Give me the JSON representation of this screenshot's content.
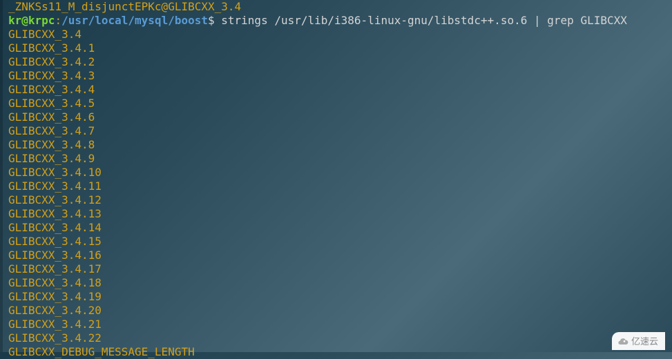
{
  "previous_line": "_ZNKSs11_M_disjunctEPKc@GLIBCXX_3.4",
  "prompt": {
    "user_host": "kr@krpc",
    "colon": ":",
    "cwd": "/usr/local/mysql/boost",
    "sign": "$ "
  },
  "command": "strings /usr/lib/i386-linux-gnu/libstdc++.so.6 | grep GLIBCXX",
  "output": [
    "GLIBCXX_3.4",
    "GLIBCXX_3.4.1",
    "GLIBCXX_3.4.2",
    "GLIBCXX_3.4.3",
    "GLIBCXX_3.4.4",
    "GLIBCXX_3.4.5",
    "GLIBCXX_3.4.6",
    "GLIBCXX_3.4.7",
    "GLIBCXX_3.4.8",
    "GLIBCXX_3.4.9",
    "GLIBCXX_3.4.10",
    "GLIBCXX_3.4.11",
    "GLIBCXX_3.4.12",
    "GLIBCXX_3.4.13",
    "GLIBCXX_3.4.14",
    "GLIBCXX_3.4.15",
    "GLIBCXX_3.4.16",
    "GLIBCXX_3.4.17",
    "GLIBCXX_3.4.18",
    "GLIBCXX_3.4.19",
    "GLIBCXX_3.4.20",
    "GLIBCXX_3.4.21",
    "GLIBCXX_3.4.22",
    "GLIBCXX_DEBUG_MESSAGE_LENGTH"
  ],
  "watermark": {
    "text": "亿速云"
  }
}
